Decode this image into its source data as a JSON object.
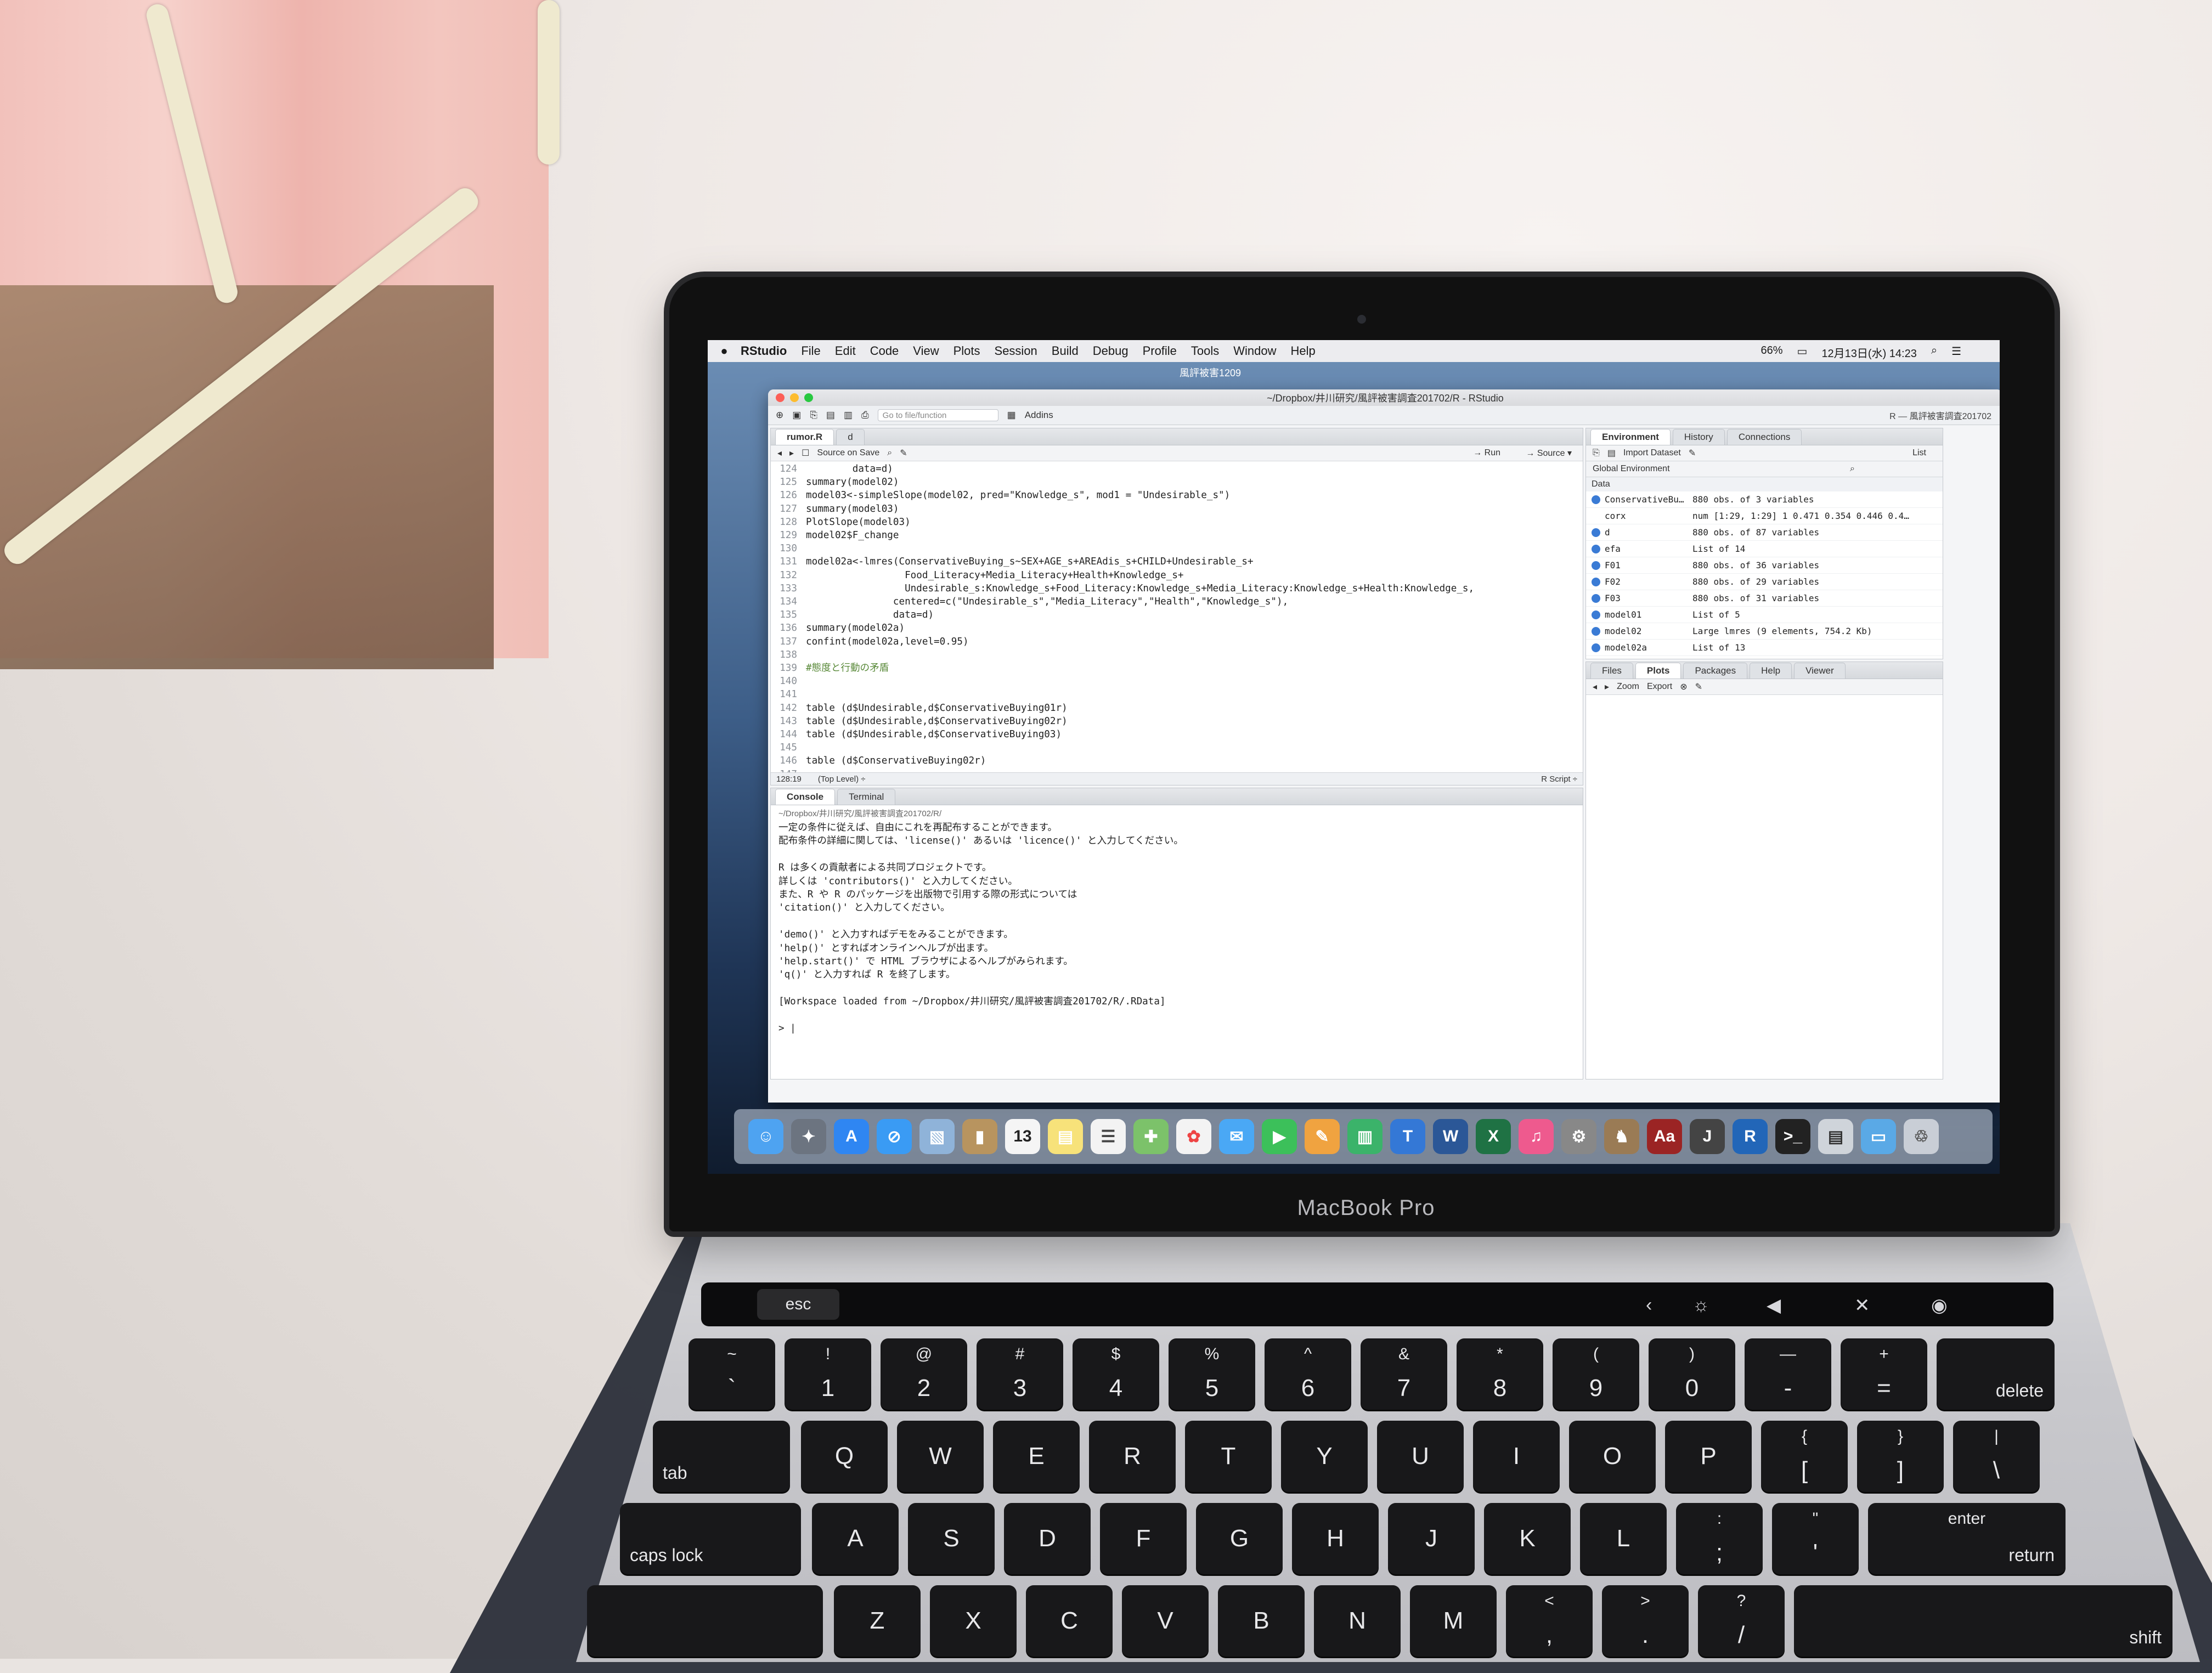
{
  "device": {
    "brand": "MacBook Pro"
  },
  "menubar": {
    "app": "RStudio",
    "items": [
      "File",
      "Edit",
      "Code",
      "View",
      "Plots",
      "Session",
      "Build",
      "Debug",
      "Profile",
      "Tools",
      "Window",
      "Help"
    ],
    "battery": "66%",
    "datetime": "12月13日(水) 14:23"
  },
  "window": {
    "folder": "風評被害1209",
    "title": "~/Dropbox/井川研究/風評被害調査201702/R - RStudio",
    "goto_placeholder": "Go to file/function",
    "addins": "Addins",
    "project": "R — 風評被害調査201702"
  },
  "editor": {
    "tabs": [
      "rumor.R",
      "d"
    ],
    "source_on_save": "Source on Save",
    "run": "Run",
    "source": "Source",
    "lines": [
      {
        "n": "124",
        "t": "        data=d)"
      },
      {
        "n": "125",
        "t": "summary(model02)"
      },
      {
        "n": "126",
        "t": "model03<-simpleSlope(model02, pred=\"Knowledge_s\", mod1 = \"Undesirable_s\")"
      },
      {
        "n": "127",
        "t": "summary(model03)"
      },
      {
        "n": "128",
        "t": "PlotSlope(model03)"
      },
      {
        "n": "129",
        "t": "model02$F_change"
      },
      {
        "n": "130",
        "t": ""
      },
      {
        "n": "131",
        "t": "model02a<-lmres(ConservativeBuying_s~SEX+AGE_s+AREAdis_s+CHILD+Undesirable_s+"
      },
      {
        "n": "132",
        "t": "                 Food_Literacy+Media_Literacy+Health+Knowledge_s+"
      },
      {
        "n": "133",
        "t": "                 Undesirable_s:Knowledge_s+Food_Literacy:Knowledge_s+Media_Literacy:Knowledge_s+Health:Knowledge_s,"
      },
      {
        "n": "134",
        "t": "               centered=c(\"Undesirable_s\",\"Media_Literacy\",\"Health\",\"Knowledge_s\"),"
      },
      {
        "n": "135",
        "t": "               data=d)"
      },
      {
        "n": "136",
        "t": "summary(model02a)"
      },
      {
        "n": "137",
        "t": "confint(model02a,level=0.95)"
      },
      {
        "n": "138",
        "t": ""
      },
      {
        "n": "139",
        "t": "#態度と行動の矛盾"
      },
      {
        "n": "140",
        "t": ""
      },
      {
        "n": "141",
        "t": ""
      },
      {
        "n": "142",
        "t": "table (d$Undesirable,d$ConservativeBuying01r)"
      },
      {
        "n": "143",
        "t": "table (d$Undesirable,d$ConservativeBuying02r)"
      },
      {
        "n": "144",
        "t": "table (d$Undesirable,d$ConservativeBuying03)"
      },
      {
        "n": "145",
        "t": ""
      },
      {
        "n": "146",
        "t": "table (d$ConservativeBuying02r)"
      },
      {
        "n": "147",
        "t": ""
      }
    ],
    "status_pos": "128:19",
    "status_scope": "(Top Level) ÷",
    "status_type": "R Script ÷"
  },
  "console": {
    "tabs": [
      "Console",
      "Terminal"
    ],
    "path": "~/Dropbox/井川研究/風評被害調査201702/R/",
    "lines": [
      "一定の条件に従えば、自由にこれを再配布することができます。",
      "配布条件の詳細に関しては、'license()' あるいは 'licence()' と入力してください。",
      "",
      "R は多くの貢献者による共同プロジェクトです。",
      "詳しくは 'contributors()' と入力してください。",
      "また、R や R のパッケージを出版物で引用する際の形式については",
      "'citation()' と入力してください。",
      "",
      "'demo()' と入力すればデモをみることができます。",
      "'help()' とすればオンラインヘルプが出ます。",
      "'help.start()' で HTML ブラウザによるヘルプがみられます。",
      "'q()' と入力すれば R を終了します。",
      "",
      "[Workspace loaded from ~/Dropbox/井川研究/風評被害調査201702/R/.RData]",
      "",
      "> |"
    ]
  },
  "environment": {
    "tabs": [
      "Environment",
      "History",
      "Connections"
    ],
    "import": "Import Dataset",
    "list_mode": "List",
    "scope": "Global Environment",
    "section": "Data",
    "rows": [
      {
        "name": "ConservativeBu…",
        "value": "880 obs. of 3 variables",
        "dot": true
      },
      {
        "name": "corx",
        "value": "num [1:29, 1:29] 1 0.471 0.354 0.446 0.4…",
        "dot": false
      },
      {
        "name": "d",
        "value": "880 obs. of 87 variables",
        "dot": true
      },
      {
        "name": "efa",
        "value": "List of 14",
        "dot": true
      },
      {
        "name": "F01",
        "value": "880 obs. of 36 variables",
        "dot": true
      },
      {
        "name": "F02",
        "value": "880 obs. of 29 variables",
        "dot": true
      },
      {
        "name": "F03",
        "value": "880 obs. of 31 variables",
        "dot": true
      },
      {
        "name": "model01",
        "value": "List of 5",
        "dot": true
      },
      {
        "name": "model02",
        "value": "Large lmres (9 elements, 754.2 Kb)",
        "dot": true
      },
      {
        "name": "model02a",
        "value": "List of 13",
        "dot": true
      }
    ]
  },
  "files_pane": {
    "tabs": [
      "Files",
      "Plots",
      "Packages",
      "Help",
      "Viewer"
    ],
    "zoom": "Zoom",
    "export": "Export"
  },
  "keyboard": {
    "esc": "esc",
    "row1": [
      [
        "~",
        "`"
      ],
      [
        "!",
        "1"
      ],
      [
        "@",
        "2"
      ],
      [
        "#",
        "3"
      ],
      [
        "$",
        "4"
      ],
      [
        "%",
        "5"
      ],
      [
        "^",
        "6"
      ],
      [
        "&",
        "7"
      ],
      [
        "*",
        "8"
      ],
      [
        "(",
        "9"
      ],
      [
        ")",
        "0"
      ],
      [
        "—",
        "-"
      ],
      [
        "+",
        "="
      ]
    ],
    "delete": "delete",
    "tab": "tab",
    "row2": [
      "Q",
      "W",
      "E",
      "R",
      "T",
      "Y",
      "U",
      "I",
      "O",
      "P"
    ],
    "row2b": [
      [
        "{",
        "["
      ],
      [
        "}",
        "]"
      ],
      [
        "|",
        "\\"
      ]
    ],
    "caps": "caps lock",
    "row3": [
      "A",
      "S",
      "D",
      "F",
      "G",
      "H",
      "J",
      "K",
      "L"
    ],
    "row3b": [
      [
        ":",
        ";"
      ],
      [
        "\"",
        "'"
      ]
    ],
    "enter_top": "enter",
    "enter_bot": "return",
    "row4": [
      "Z",
      "X",
      "C",
      "V",
      "B",
      "N",
      "M"
    ],
    "row4b": [
      [
        "<",
        ","
      ],
      [
        ">",
        "."
      ],
      [
        "?",
        "/"
      ]
    ],
    "shift": "shift"
  },
  "colors": {
    "accent": "#3a7bd5",
    "menubar": "#ececef"
  }
}
